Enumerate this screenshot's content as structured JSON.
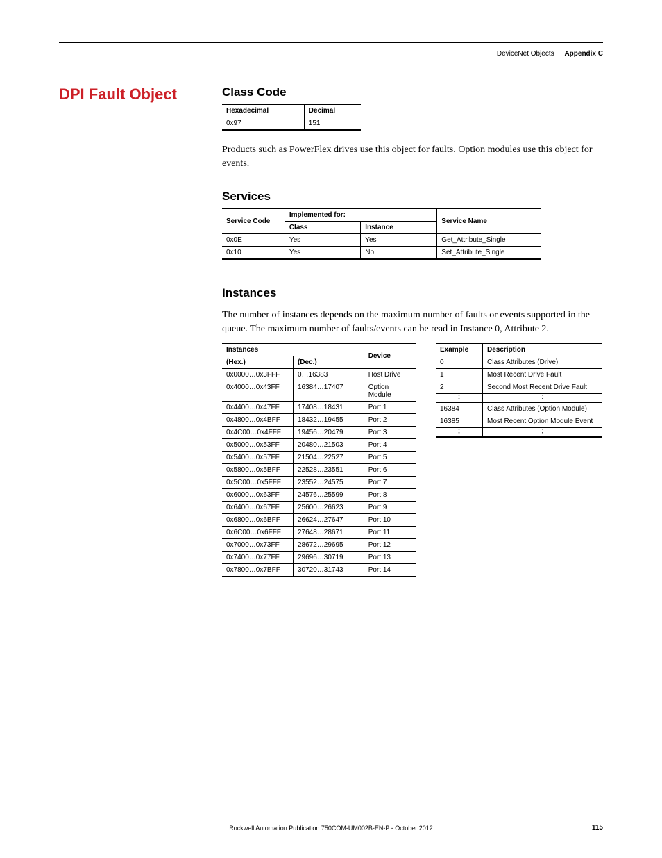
{
  "header": {
    "left": "DeviceNet Objects",
    "right": "Appendix C"
  },
  "title": "DPI Fault Object",
  "classCode": {
    "heading": "Class Code",
    "headers": [
      "Hexadecimal",
      "Decimal"
    ],
    "row": [
      "0x97",
      "151"
    ]
  },
  "intro": "Products such as PowerFlex drives use this object for faults. Option modules use this object for events.",
  "services": {
    "heading": "Services",
    "topHeaders": {
      "code": "Service Code",
      "impl": "Implemented for:",
      "name": "Service Name"
    },
    "subHeaders": {
      "class": "Class",
      "instance": "Instance"
    },
    "rows": [
      {
        "code": "0x0E",
        "class": "Yes",
        "instance": "Yes",
        "name": "Get_Attribute_Single"
      },
      {
        "code": "0x10",
        "class": "Yes",
        "instance": "No",
        "name": "Set_Attribute_Single"
      }
    ]
  },
  "instances": {
    "heading": "Instances",
    "intro": "The number of instances depends on the maximum number of faults or events supported in the queue. The maximum number of faults/events can be read in Instance 0, Attribute 2.",
    "headers": {
      "instances": "Instances",
      "device": "Device",
      "hex": "(Hex.)",
      "dec": "(Dec.)"
    },
    "rows": [
      {
        "hex": "0x0000…0x3FFF",
        "dec": "0…16383",
        "device": "Host Drive"
      },
      {
        "hex": "0x4000…0x43FF",
        "dec": "16384…17407",
        "device": "Option Module"
      },
      {
        "hex": "0x4400…0x47FF",
        "dec": "17408…18431",
        "device": "Port 1"
      },
      {
        "hex": "0x4800…0x4BFF",
        "dec": "18432…19455",
        "device": "Port 2"
      },
      {
        "hex": "0x4C00…0x4FFF",
        "dec": "19456…20479",
        "device": "Port 3"
      },
      {
        "hex": "0x5000…0x53FF",
        "dec": "20480…21503",
        "device": "Port 4"
      },
      {
        "hex": "0x5400…0x57FF",
        "dec": "21504…22527",
        "device": "Port 5"
      },
      {
        "hex": "0x5800…0x5BFF",
        "dec": "22528…23551",
        "device": "Port 6"
      },
      {
        "hex": "0x5C00…0x5FFF",
        "dec": "23552…24575",
        "device": "Port 7"
      },
      {
        "hex": "0x6000…0x63FF",
        "dec": "24576…25599",
        "device": "Port 8"
      },
      {
        "hex": "0x6400…0x67FF",
        "dec": "25600…26623",
        "device": "Port 9"
      },
      {
        "hex": "0x6800…0x6BFF",
        "dec": "26624…27647",
        "device": "Port 10"
      },
      {
        "hex": "0x6C00…0x6FFF",
        "dec": "27648…28671",
        "device": "Port 11"
      },
      {
        "hex": "0x7000…0x73FF",
        "dec": "28672…29695",
        "device": "Port 12"
      },
      {
        "hex": "0x7400…0x77FF",
        "dec": "29696…30719",
        "device": "Port 13"
      },
      {
        "hex": "0x7800…0x7BFF",
        "dec": "30720…31743",
        "device": "Port 14"
      }
    ]
  },
  "example": {
    "headers": {
      "example": "Example",
      "description": "Description"
    },
    "rows": [
      {
        "ex": "0",
        "desc": "Class Attributes (Drive)"
      },
      {
        "ex": "1",
        "desc": "Most Recent Drive Fault"
      },
      {
        "ex": "2",
        "desc": "Second Most Recent Drive Fault"
      },
      {
        "ex": "⋮",
        "desc": "⋮"
      },
      {
        "ex": "16384",
        "desc": "Class Attributes (Option Module)"
      },
      {
        "ex": "16385",
        "desc": "Most Recent Option Module Event"
      },
      {
        "ex": "⋮",
        "desc": "⋮"
      }
    ]
  },
  "footer": "Rockwell Automation Publication 750COM-UM002B-EN-P - October 2012",
  "pageNum": "115"
}
